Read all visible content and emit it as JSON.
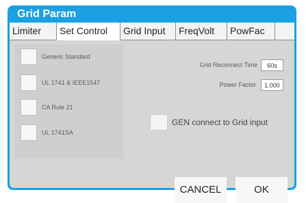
{
  "dialog": {
    "title": "Grid Param"
  },
  "tabs": [
    {
      "label": "Limiter"
    },
    {
      "label": "Set Control"
    },
    {
      "label": "Grid Input"
    },
    {
      "label": "FreqVolt"
    },
    {
      "label": "PowFac"
    }
  ],
  "standards": [
    {
      "label": "Generic Standard",
      "checked": false
    },
    {
      "label": "UL 1741 & IEEE1547",
      "checked": false
    },
    {
      "label": "CA Rule 21",
      "checked": false
    },
    {
      "label": "UL 1741SA",
      "checked": false
    }
  ],
  "fields": {
    "reconnect_label": "Grid Reconnect Time",
    "reconnect_value": "60s",
    "power_factor_label": "Power Factor",
    "power_factor_value": "1.000"
  },
  "gen_connect": {
    "label": "GEN connect to Grid input",
    "checked": false
  },
  "buttons": {
    "cancel": "CANCEL",
    "ok": "OK"
  },
  "colors": {
    "title_bar": "#1aa0e3",
    "panel_bg": "#d6d6d6"
  }
}
